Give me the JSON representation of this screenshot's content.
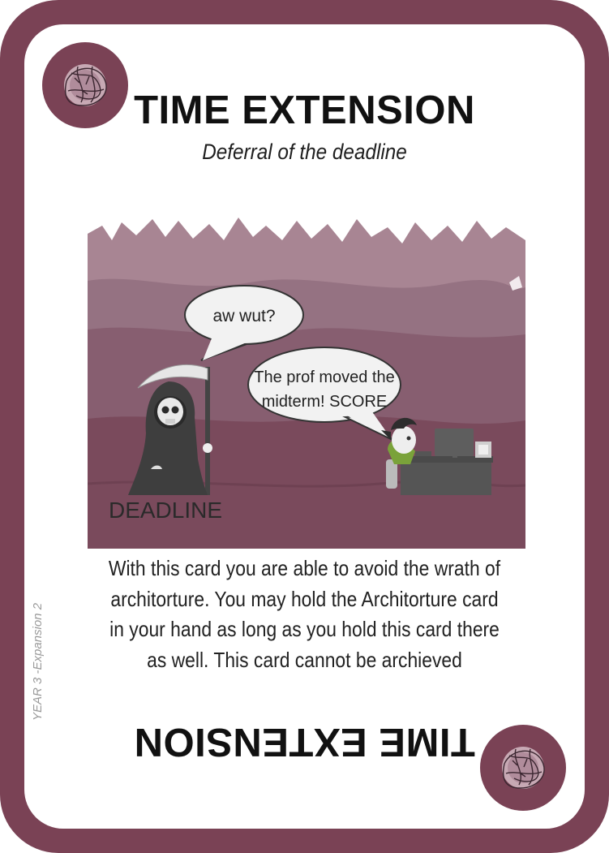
{
  "card": {
    "title": "TIME EXTENSION",
    "subtitle": "Deferral of the deadline",
    "body": "With this card you are able to avoid the wrath of architorture. You may hold the Architorture card in your hand as long as you hold this card there as well. This card cannot be archieved",
    "title_flipped": "TIME EXTENSION",
    "edition": "YEAR 3 -Expansion 2"
  },
  "illustration": {
    "bubble_top": "aw wut?",
    "bubble_bottom_line1": "The prof moved the",
    "bubble_bottom_line2": "midterm! SCORE",
    "deadline_label": "DEADLINE"
  },
  "icons": {
    "corner_emblem": "scribble-ball-icon"
  },
  "colors": {
    "frame": "#7a4255",
    "scene_dark": "#7a4a5c",
    "scene_light": "#a88593"
  }
}
